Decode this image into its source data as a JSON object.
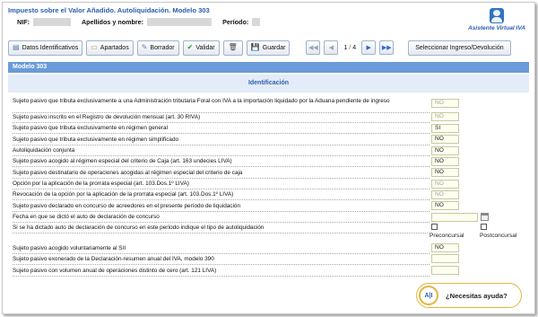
{
  "header": {
    "title": "Impuesto sobre el Valor Añadido. Autoliquidación. Modelo 303",
    "nif_label": "NIF:",
    "name_label": "Apellidos y nombre:",
    "period_label": "Período:",
    "assistant_label": "Asistente Virtual IVA"
  },
  "toolbar": {
    "identificativos": "Datos Identificativos",
    "apartados": "Apartados",
    "borrador": "Borrador",
    "validar": "Validar",
    "guardar": "Guardar",
    "page_current": "1",
    "page_sep": "/",
    "page_total": "4",
    "seleccionar": "Seleccionar Ingreso/Devolución"
  },
  "section": {
    "title": "Modelo 303",
    "subtitle": "Identificación"
  },
  "rows": [
    {
      "q": "Sujeto pasivo que tributa exclusivamente a una Administración tributaria Foral con IVA a la importación liquidado por la Aduana pendiente de ingreso",
      "v": "NO"
    },
    {
      "q": "Sujeto pasivo inscrito en el Registro de devolución mensual (art. 30 RIVA)",
      "v": "NO"
    },
    {
      "q": "Sujeto pasivo que tributa exclusivamente en régimen general",
      "v": "SI"
    },
    {
      "q": "Sujeto pasivo que tributa exclusivamente en régimen simplificado",
      "v": "NO"
    },
    {
      "q": "Autoliquidación conjunta",
      "v": "NO"
    },
    {
      "q": "Sujeto pasivo acogido al régimen especial del criterio de Caja (art. 163 undecies LIVA)",
      "v": "NO"
    },
    {
      "q": "Sujeto pasivo destinatario de operaciones acogidas al régimen especial del criterio de caja",
      "v": "NO"
    },
    {
      "q": "Opción por la aplicación de la prorrata especial (art. 103.Dos.1º LIVA)",
      "v": "NO"
    },
    {
      "q": "Revocación de la opción por la aplicación de la prorrata especial (art. 103.Dos.1º LIVA)",
      "v": "NO"
    },
    {
      "q": "Sujeto pasivo declarado en concurso de acreedores en el presente período de liquidación",
      "v": "NO"
    },
    {
      "q": "Fecha en que se dictó el auto de declaración de concurso",
      "v": ""
    },
    {
      "q": "Si se ha dictado auto de declaración de concurso en este período indique el tipo de autoliquidación",
      "v": ""
    },
    {
      "q": "Sujeto pasivo acogido voluntariamente al SII",
      "v": "NO"
    },
    {
      "q": "Sujeto pasivo exonerado de la Declaración-resumen anual del IVA, modelo 390",
      "v": ""
    },
    {
      "q": "Sujeto pasivo con volumen anual de operaciones distinto de cero (art. 121 LIVA)",
      "v": ""
    }
  ],
  "concurso_options": {
    "preconcursal": "Preconcursal",
    "postconcursal": "Postconcursal"
  },
  "help": {
    "label": "¿Necesitas ayuda?",
    "icon_text": "A|I"
  },
  "colors": {
    "accent": "#2a5fb0",
    "section_bar": "#6b9bd8",
    "subhead_bg": "#e3ecf8",
    "field_bg": "#fffff0",
    "help_border": "#e2b640"
  }
}
